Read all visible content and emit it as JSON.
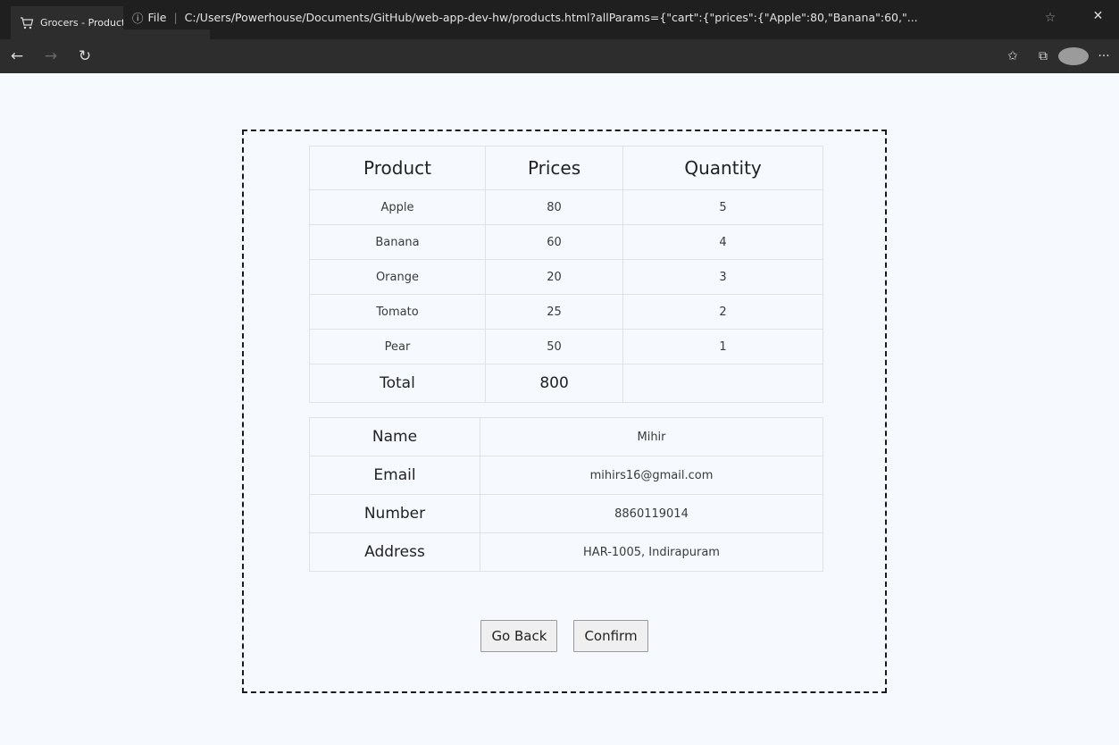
{
  "browser": {
    "tab_title": "Grocers - Products",
    "tab_close": "×",
    "new_tab": "+",
    "address_protocol": "File",
    "address_url": "C:/Users/Powerhouse/Documents/GitHub/web-app-dev-hw/products.html?allParams={\"cart\":{\"prices\":{\"Apple\":80,\"Banana\":60,\"..."
  },
  "products_table": {
    "headers": [
      "Product",
      "Prices",
      "Quantity"
    ],
    "rows": [
      {
        "product": "Apple",
        "price": "80",
        "quantity": "5"
      },
      {
        "product": "Banana",
        "price": "60",
        "quantity": "4"
      },
      {
        "product": "Orange",
        "price": "20",
        "quantity": "3"
      },
      {
        "product": "Tomato",
        "price": "25",
        "quantity": "2"
      },
      {
        "product": "Pear",
        "price": "50",
        "quantity": "1"
      }
    ],
    "total_label": "Total",
    "total_value": "800",
    "total_quantity": ""
  },
  "customer": {
    "name_label": "Name",
    "name_value": "Mihir",
    "email_label": "Email",
    "email_value": "mihirs16@gmail.com",
    "number_label": "Number",
    "number_value": "8860119014",
    "address_label": "Address",
    "address_value": "HAR-1005, Indirapuram"
  },
  "actions": {
    "go_back": "Go Back",
    "confirm": "Confirm"
  },
  "colors": {
    "page_bg": "#f6f9fd",
    "chrome_dark": "#1f1f1f",
    "toolbar": "#2d2d2d"
  }
}
